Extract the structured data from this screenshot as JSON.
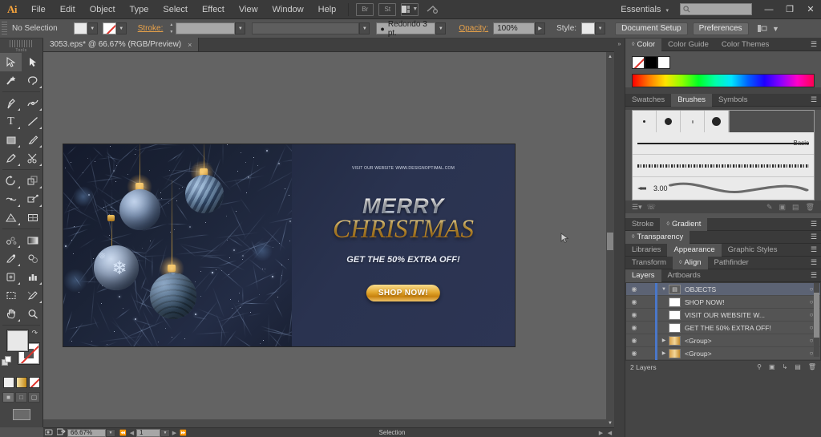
{
  "app": {
    "logo": "Ai",
    "title": "Adobe Illustrator"
  },
  "menubar": {
    "items": [
      "File",
      "Edit",
      "Object",
      "Type",
      "Select",
      "Effect",
      "View",
      "Window",
      "Help"
    ],
    "icons": [
      "bridge-icon",
      "stock-icon",
      "arrange-documents-icon",
      "sync-settings-icon"
    ],
    "workspace": "Essentials",
    "search_placeholder": "",
    "window_buttons": [
      "minimize",
      "restore",
      "close"
    ]
  },
  "controlbar": {
    "selection_status": "No Selection",
    "fill_label": "Fill",
    "stroke_label": "Stroke:",
    "stroke_weight": "",
    "stroke_profile": "",
    "brush_definition": "Redondo 3 pt.",
    "opacity_label": "Opacity:",
    "opacity_value": "100%",
    "style_label": "Style:",
    "document_setup": "Document Setup",
    "preferences": "Preferences",
    "align_icon": "align-icon"
  },
  "document": {
    "tab_title": "3053.eps* @ 66.67% (RGB/Preview)",
    "close_label": "×"
  },
  "toolbar": {
    "title": "Tools",
    "tools": [
      {
        "name": "selection-tool",
        "glyph": "selection",
        "selected": true
      },
      {
        "name": "direct-selection-tool",
        "glyph": "direct-selection",
        "selected": false
      },
      {
        "name": "magic-wand-tool",
        "glyph": "magic-wand",
        "selected": false
      },
      {
        "name": "lasso-tool",
        "glyph": "lasso",
        "selected": false
      },
      {
        "name": "pen-tool",
        "glyph": "pen",
        "selected": false
      },
      {
        "name": "curvature-tool",
        "glyph": "curvature",
        "selected": false
      },
      {
        "name": "type-tool",
        "glyph": "type",
        "selected": false
      },
      {
        "name": "line-segment-tool",
        "glyph": "line",
        "selected": false
      },
      {
        "name": "rectangle-tool",
        "glyph": "rectangle",
        "selected": false
      },
      {
        "name": "paintbrush-tool",
        "glyph": "paintbrush",
        "selected": false
      },
      {
        "name": "pencil-tool",
        "glyph": "pencil",
        "selected": false
      },
      {
        "name": "eraser-tool",
        "glyph": "scissors",
        "selected": false
      },
      {
        "name": "rotate-tool",
        "glyph": "rotate",
        "selected": false
      },
      {
        "name": "scale-tool",
        "glyph": "scale",
        "selected": false
      },
      {
        "name": "width-tool",
        "glyph": "width",
        "selected": false
      },
      {
        "name": "free-transform-tool",
        "glyph": "free-transform",
        "selected": false
      },
      {
        "name": "shape-builder-tool",
        "glyph": "shape-builder",
        "selected": false
      },
      {
        "name": "perspective-grid-tool",
        "glyph": "perspective",
        "selected": false
      },
      {
        "name": "mesh-tool",
        "glyph": "mesh",
        "selected": false
      },
      {
        "name": "gradient-tool",
        "glyph": "gradient",
        "selected": false
      },
      {
        "name": "eyedropper-tool",
        "glyph": "eyedropper",
        "selected": false
      },
      {
        "name": "blend-tool",
        "glyph": "blend",
        "selected": false
      },
      {
        "name": "symbol-sprayer-tool",
        "glyph": "symbol-sprayer",
        "selected": false
      },
      {
        "name": "column-graph-tool",
        "glyph": "graph",
        "selected": false
      },
      {
        "name": "artboard-tool",
        "glyph": "artboard",
        "selected": false
      },
      {
        "name": "slice-tool",
        "glyph": "slice",
        "selected": false
      },
      {
        "name": "hand-tool",
        "glyph": "hand",
        "selected": false
      },
      {
        "name": "zoom-tool",
        "glyph": "zoom",
        "selected": false
      }
    ],
    "fill_color": "#e8e8e8",
    "stroke_color": "none",
    "color_modes": [
      "color-swatch",
      "gradient-swatch",
      "none-swatch"
    ],
    "screen_modes": [
      "draw-normal",
      "draw-behind",
      "draw-inside"
    ]
  },
  "canvas": {
    "artboard": {
      "headline_small": "VISIT OUR WEBSITE",
      "headline_url": "WWW.DESIGNOPTIMAL.COM",
      "merry": "MERRY",
      "christmas": "CHRISTMAS",
      "offer": "GET THE 50% EXTRA OFF!",
      "button": "SHOP NOW!",
      "bg_color": "#232b43",
      "gold_color": "#e3a82f"
    },
    "cursor": "arrow-cursor"
  },
  "statusbar": {
    "zoom": "66.67%",
    "artboard_number": "1",
    "status_text": "Selection"
  },
  "panels": {
    "color_group": {
      "tabs": [
        "Color",
        "Color Guide",
        "Color Themes"
      ],
      "active": "Color",
      "swatches": [
        "none",
        "#000000",
        "#ffffff"
      ]
    },
    "brushes_group": {
      "tabs": [
        "Swatches",
        "Brushes",
        "Symbols"
      ],
      "active": "Brushes",
      "basic_label": "Basic",
      "width_value": "3.00"
    },
    "stroke_group": {
      "tabs": [
        "Stroke",
        "Gradient"
      ],
      "active": "Gradient"
    },
    "transparency_group": {
      "tabs": [
        "Transparency"
      ],
      "active": "Transparency"
    },
    "appearance_group": {
      "tabs": [
        "Libraries",
        "Appearance",
        "Graphic Styles"
      ],
      "active": "Appearance"
    },
    "align_group": {
      "tabs": [
        "Transform",
        "Align",
        "Pathfinder"
      ],
      "active": "Align"
    },
    "layers_group": {
      "tabs": [
        "Layers",
        "Artboards"
      ],
      "active": "Layers",
      "rows": [
        {
          "name": "OBJECTS",
          "type": "layer",
          "selected": true,
          "expanded": true
        },
        {
          "name": "SHOP NOW!",
          "type": "text",
          "selected": false,
          "expanded": false
        },
        {
          "name": "VISIT OUR WEBSITE W...",
          "type": "text",
          "selected": false,
          "expanded": false
        },
        {
          "name": "GET THE 50% EXTRA OFF!",
          "type": "text",
          "selected": false,
          "expanded": false
        },
        {
          "name": "<Group>",
          "type": "group",
          "selected": false,
          "expanded": false
        },
        {
          "name": "<Group>",
          "type": "group",
          "selected": false,
          "expanded": false
        }
      ],
      "footer_count": "2 Layers"
    }
  }
}
